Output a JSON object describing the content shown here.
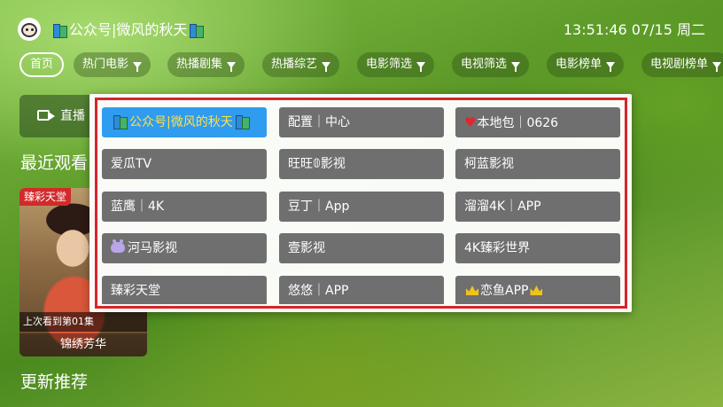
{
  "header": {
    "title": "公众号|微风的秋天",
    "clock": "13:51:46 07/15 周二"
  },
  "tabs": [
    {
      "label": "首页",
      "has_filter": false,
      "active": true
    },
    {
      "label": "热门电影",
      "has_filter": true
    },
    {
      "label": "热播剧集",
      "has_filter": true
    },
    {
      "label": "热播综艺",
      "has_filter": true
    },
    {
      "label": "电影筛选",
      "has_filter": true
    },
    {
      "label": "电视筛选",
      "has_filter": true
    },
    {
      "label": "电影榜单",
      "has_filter": true
    },
    {
      "label": "电视剧榜单",
      "has_filter": true
    }
  ],
  "main": {
    "live_label": "直播",
    "recent_title": "最近观看",
    "update_title": "更新推荐",
    "recent_item": {
      "badge": "臻彩天堂",
      "progress": "上次看到第01集",
      "name": "锦绣芳华"
    }
  },
  "popup": {
    "items": [
      {
        "label": "公众号|微风的秋天",
        "icon": "book-icon",
        "selected": true
      },
      {
        "label": "配置｜中心"
      },
      {
        "label": "本地包｜0626",
        "icon": "heart-icon"
      },
      {
        "label": "爱瓜TV"
      },
      {
        "label": "旺旺𝟘影视"
      },
      {
        "label": "柯蓝影视"
      },
      {
        "label": "蓝鹰｜4K"
      },
      {
        "label": "豆丁｜App"
      },
      {
        "label": "溜溜4K｜APP"
      },
      {
        "label": "河马影视",
        "icon": "hippo-icon"
      },
      {
        "label": "壹影视"
      },
      {
        "label": "4K臻彩世界"
      },
      {
        "label": "臻彩天堂"
      },
      {
        "label": "悠悠｜APP"
      },
      {
        "label": "恋鱼APP",
        "icon": "crown-icon"
      }
    ]
  },
  "colors": {
    "popup_border": "#d6252b",
    "item_bg": "#6f6f6f",
    "selected_bg": "#2f9cf0",
    "selected_text": "#ffe04a"
  }
}
